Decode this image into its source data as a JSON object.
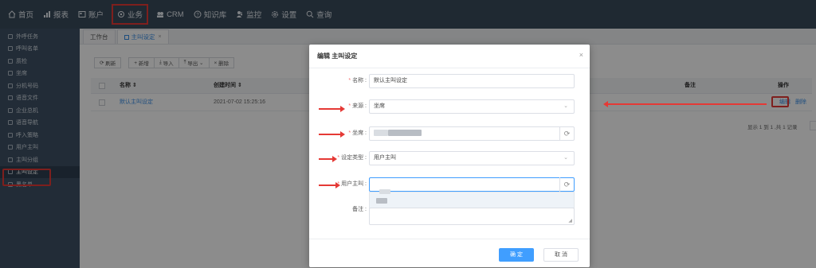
{
  "topnav": {
    "items": [
      {
        "label": "首页",
        "icon": "home-icon"
      },
      {
        "label": "报表",
        "icon": "bar-chart-icon"
      },
      {
        "label": "账户",
        "icon": "account-icon"
      },
      {
        "label": "业务",
        "icon": "business-icon",
        "active": true
      },
      {
        "label": "CRM",
        "icon": "crm-icon"
      },
      {
        "label": "知识库",
        "icon": "knowledge-icon"
      },
      {
        "label": "监控",
        "icon": "monitor-icon"
      },
      {
        "label": "设置",
        "icon": "gear-icon"
      },
      {
        "label": "查询",
        "icon": "search-icon"
      }
    ]
  },
  "sidebar": {
    "items": [
      {
        "label": "外呼任务"
      },
      {
        "label": "呼叫名单"
      },
      {
        "label": "质检"
      },
      {
        "label": "坐席"
      },
      {
        "label": "分机号码"
      },
      {
        "label": "语音文件"
      },
      {
        "label": "企业总机"
      },
      {
        "label": "语音导航"
      },
      {
        "label": "呼入策略"
      },
      {
        "label": "用户主叫"
      },
      {
        "label": "主叫分组"
      },
      {
        "label": "主叫设定",
        "active": true
      },
      {
        "label": "黑名单"
      }
    ]
  },
  "tabs": [
    {
      "label": "工作台"
    },
    {
      "label": "主叫设定",
      "closable": true
    }
  ],
  "toolbar": {
    "refresh": "刷新",
    "add": "新增",
    "import": "导入",
    "export": "导出",
    "delete": "删除"
  },
  "table": {
    "headers": {
      "name": "名称 ⇕",
      "created": "创建时间 ⇕",
      "remark": "备注",
      "ops": "操作"
    },
    "rows": [
      {
        "name": "默认主叫设定",
        "created": "2021-07-02 15:25:16",
        "edit": "编辑",
        "delete": "删除"
      }
    ]
  },
  "pager": {
    "text": "显示 1 到 1 ,共 1 记录"
  },
  "modal": {
    "title": "编辑 主叫设定",
    "close": "×",
    "fields": {
      "name_label": "名称 :",
      "name_value": "默认主叫设定",
      "source_label": "来源 :",
      "source_value": "坐席",
      "agent_label": "坐席 :",
      "type_label": "设定类型 :",
      "type_value": "用户主叫",
      "caller_label": "用户主叫 :",
      "remark_label": "备注 :"
    },
    "ok": "确 定",
    "cancel": "取 消"
  },
  "colors": {
    "nav_bg": "#3a4b5c",
    "sidebar_bg": "#3f5164",
    "primary": "#409eff",
    "annotation_red": "#e53935"
  }
}
